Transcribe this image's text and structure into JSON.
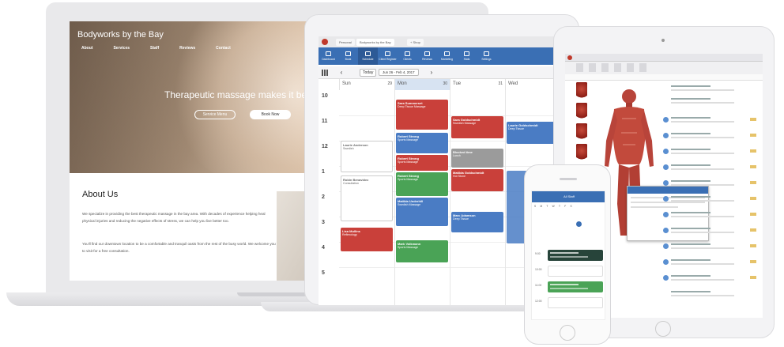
{
  "laptop": {
    "site_name": "Bodyworks by the Bay",
    "nav": [
      "About",
      "Services",
      "Staff",
      "Reviews",
      "Contact"
    ],
    "hero_heading": "Therapeutic massage makes it bet",
    "buttons": {
      "menu": "Service Menu",
      "book": "Book Now"
    },
    "about_title": "About Us",
    "about_p1": "We specialize in providing the best therapeutic massage in the bay area. With decades of experience helping heal physical injuries and reducing the negative effects of stress, we can help you live better too.",
    "about_p2": "You'll find our downtown location to be a comfortable and tranquil oasis from the rest of the busy world. We welcome you to visit for a free consultation."
  },
  "scheduler": {
    "tabs": [
      "Personal",
      "Bodyworks by the Bay",
      "+ Shop"
    ],
    "toolbar": [
      "Dashboard",
      "Book",
      "Schedule",
      "Client Register",
      "Clients",
      "Reviews",
      "Marketing",
      "Stats",
      "Settings"
    ],
    "active_tool": "Schedule",
    "today_label": "Today",
    "date_range": "Jun 26 - Feb 4, 2017",
    "days": [
      {
        "name": "Sun",
        "num": "29"
      },
      {
        "name": "Mon",
        "num": "30"
      },
      {
        "name": "Tue",
        "num": "31"
      },
      {
        "name": "Wed",
        "num": "1"
      }
    ],
    "hours": [
      "10",
      "11",
      "12",
      "1",
      "2",
      "3",
      "4",
      "5"
    ],
    "appointments": [
      {
        "name": "Sara Summerset",
        "detail": "Deep Tissue Massage",
        "color": "#c9403a"
      },
      {
        "name": "Sara Goldschmidt",
        "detail": "Swedish Massage",
        "color": "#c9403a"
      },
      {
        "name": "Laurie Goldschmidt",
        "detail": "Deep Tissue",
        "color": "#4a7cc4"
      },
      {
        "name": "Robert Strong",
        "detail": "Sports Massage",
        "color": "#4a7cc4"
      },
      {
        "name": "Robert Strong",
        "detail": "Sports Massage",
        "color": "#c9403a"
      },
      {
        "name": "Blocked time",
        "detail": "Lunch",
        "color": "#9b9b9b"
      },
      {
        "name": "Robert Strong",
        "detail": "Sports Massage",
        "color": "#4aa356"
      },
      {
        "name": "Matilda Goldschmidt",
        "detail": "Hot Stone",
        "color": "#c9403a"
      },
      {
        "name": "Matilda Underhill",
        "detail": "Swedish Massage",
        "color": "#4a7cc4"
      },
      {
        "name": "Marc Adamson",
        "detail": "Deep Tissue",
        "color": "#4a7cc4"
      },
      {
        "name": "Lisa Mullins",
        "detail": "Reflexology",
        "color": "#c9403a"
      },
      {
        "name": "Mark Volkmann",
        "detail": "Sports Massage",
        "color": "#4aa356"
      },
      {
        "name": "Laurie Anderson",
        "detail": "Swedish",
        "color": "#ffffff"
      },
      {
        "name": "Robin Benavidez",
        "detail": "Consultation",
        "color": "#ffffff"
      }
    ]
  },
  "phone": {
    "header": "All Staff",
    "weekdays": [
      "S",
      "M",
      "T",
      "W",
      "T",
      "F",
      "S"
    ],
    "rows": [
      {
        "time": "9:00",
        "color": "#27443a"
      },
      {
        "time": "10:00",
        "color": "#ffffff"
      },
      {
        "time": "11:00",
        "color": "#4aa356"
      },
      {
        "time": "12:00",
        "color": "#ffffff"
      }
    ]
  },
  "colors": {
    "toolbar_blue": "#3a6fb4",
    "accent_red": "#c9403a",
    "accent_green": "#4aa356"
  }
}
